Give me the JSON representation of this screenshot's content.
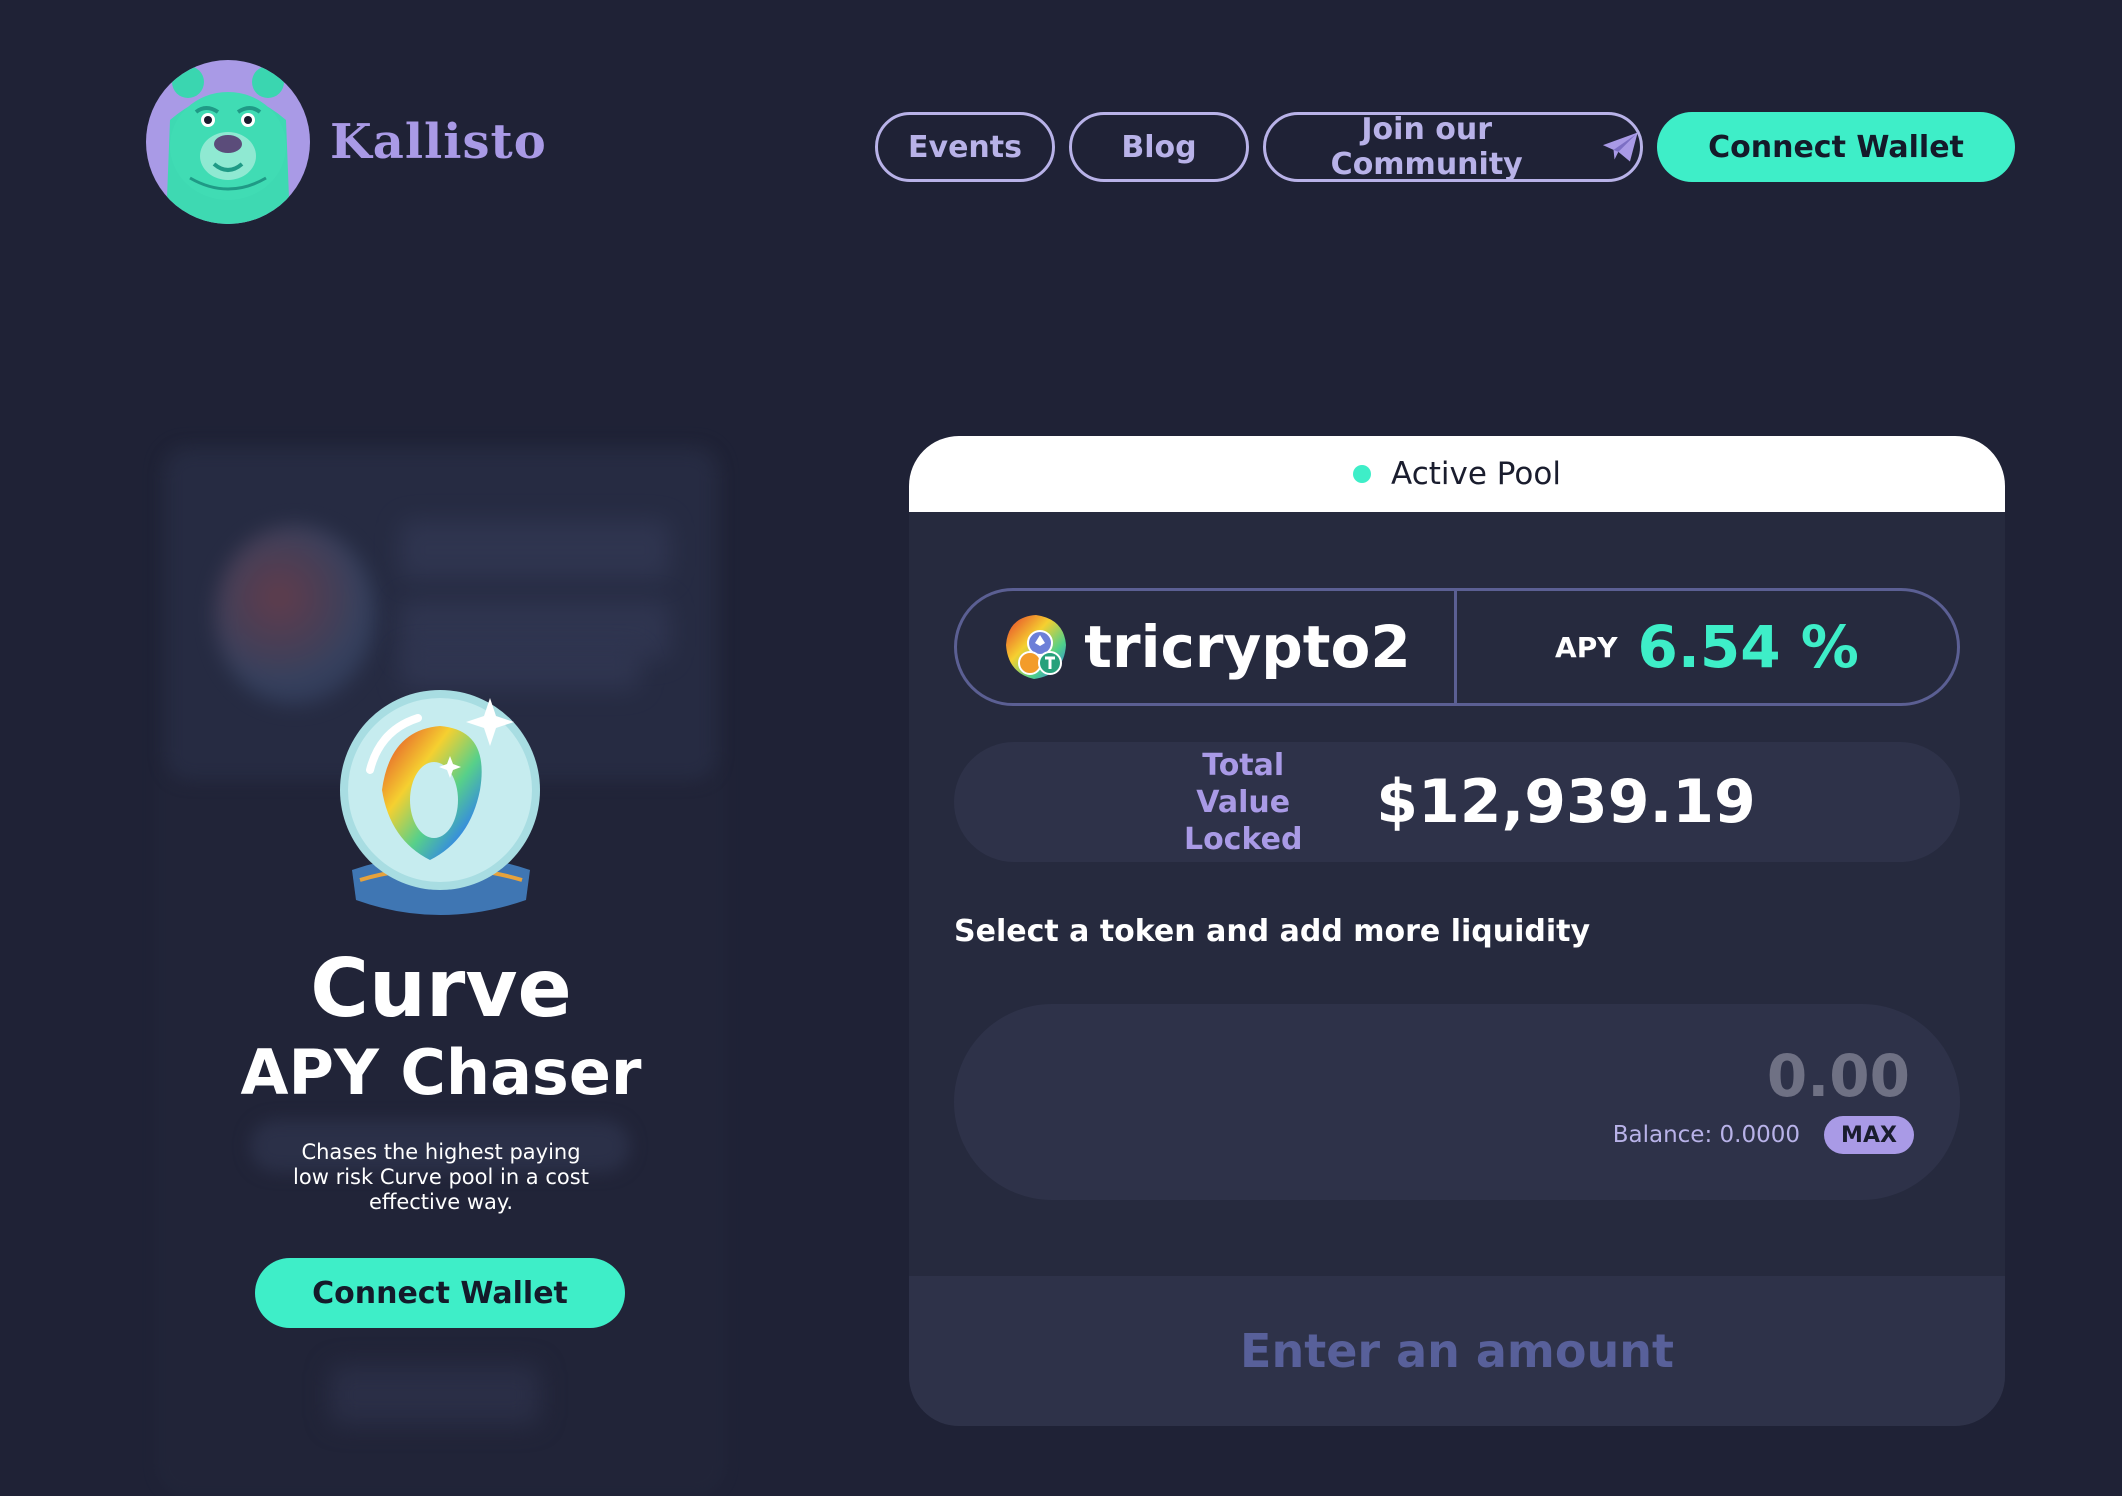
{
  "header": {
    "brand": "Kallisto",
    "nav": {
      "events": "Events",
      "blog": "Blog",
      "community": "Join our Community"
    },
    "connect_wallet": "Connect Wallet"
  },
  "strategy": {
    "title": "Curve",
    "subtitle": "APY Chaser",
    "description": "Chases the highest paying low risk Curve pool in a cost effective way.",
    "connect_wallet": "Connect Wallet"
  },
  "pool": {
    "status": "Active Pool",
    "name": "tricrypto2",
    "apy_label": "APY",
    "apy_value": "6.54 %",
    "tvl_label": "Total Value Locked",
    "tvl_value": "$12,939.19",
    "select_label": "Select a token and add more liquidity",
    "amount_placeholder": "0.00",
    "balance": "Balance: 0.0000",
    "max_label": "MAX",
    "submit_label": "Enter an amount"
  },
  "colors": {
    "background": "#1f2236",
    "accent": "#3eeec8",
    "lavender": "#a99ae6",
    "panel": "#262a3e"
  },
  "icons": [
    "bear-logo-icon",
    "telegram-icon",
    "crystal-ball-icon",
    "tricrypto-token-icon"
  ]
}
